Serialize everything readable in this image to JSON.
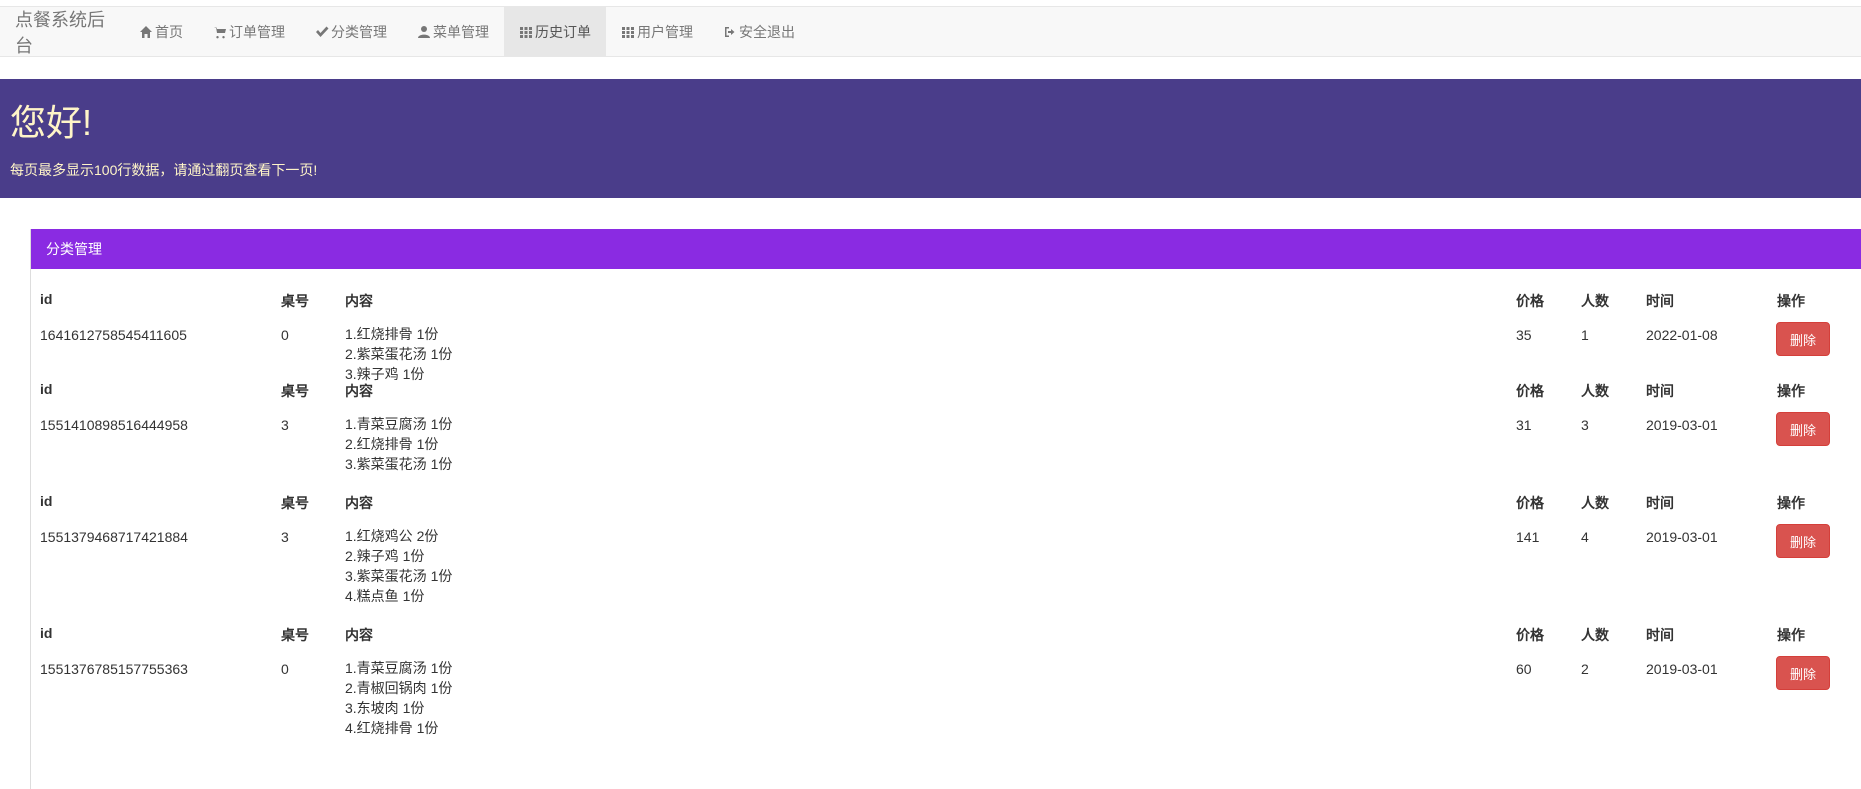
{
  "navbar": {
    "brand": "点餐系统后台",
    "items": [
      {
        "label": "首页",
        "icon": "home-icon"
      },
      {
        "label": "订单管理",
        "icon": "cart-icon"
      },
      {
        "label": "分类管理",
        "icon": "check-icon"
      },
      {
        "label": "菜单管理",
        "icon": "user-icon"
      },
      {
        "label": "历史订单",
        "icon": "grid-icon",
        "active": true
      },
      {
        "label": "用户管理",
        "icon": "grid-icon"
      },
      {
        "label": "安全退出",
        "icon": "logout-icon"
      }
    ]
  },
  "jumbotron": {
    "title": "您好!",
    "subtitle": "每页最多显示100行数据，请通过翻页查看下一页!"
  },
  "panel": {
    "heading": "分类管理"
  },
  "table": {
    "headers": {
      "id": "id",
      "table_no": "桌号",
      "content": "内容",
      "price": "价格",
      "people": "人数",
      "time": "时间",
      "action": "操作"
    },
    "delete_label": "删除",
    "orders": [
      {
        "id": "1641612758545411605",
        "table_no": "0",
        "content": [
          "1.红烧排骨   1份",
          "2.紫菜蛋花汤   1份",
          "3.辣子鸡   1份"
        ],
        "price": "35",
        "people": "1",
        "time": "2022-01-08"
      },
      {
        "id": "1551410898516444958",
        "table_no": "3",
        "content": [
          "1.青菜豆腐汤   1份",
          "2.红烧排骨   1份",
          "3.紫菜蛋花汤   1份"
        ],
        "price": "31",
        "people": "3",
        "time": "2019-03-01"
      },
      {
        "id": "1551379468717421884",
        "table_no": "3",
        "content": [
          "1.红烧鸡公   2份",
          "2.辣子鸡   1份",
          "3.紫菜蛋花汤   1份",
          "4.糕点鱼   1份"
        ],
        "price": "141",
        "people": "4",
        "time": "2019-03-01"
      },
      {
        "id": "1551376785157755363",
        "table_no": "0",
        "content": [
          "1.青菜豆腐汤   1份",
          "2.青椒回锅肉   1份",
          "3.东坡肉   1份",
          "4.红烧排骨   1份"
        ],
        "price": "60",
        "people": "2",
        "time": "2019-03-01"
      }
    ]
  }
}
